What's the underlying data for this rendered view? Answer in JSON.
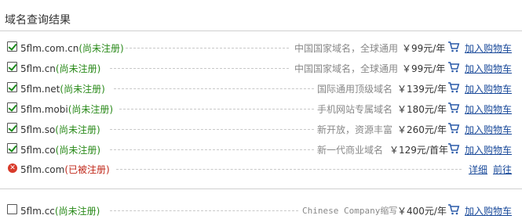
{
  "header": {
    "title": "域名查询结果"
  },
  "results": [
    {
      "domain": "5flm.com.cn",
      "status": "(尚未注册)",
      "desc": "中国国家域名，全球通用",
      "price": "￥99元/年",
      "cart": "加入购物车"
    },
    {
      "domain": "5flm.cn",
      "status": "(尚未注册)",
      "desc": "中国国家域名，全球通用",
      "price": "￥99元/年",
      "cart": "加入购物车"
    },
    {
      "domain": "5flm.net",
      "status": "(尚未注册)",
      "desc": "国际通用顶级域名",
      "price": "￥139元/年",
      "cart": "加入购物车"
    },
    {
      "domain": "5flm.mobi",
      "status": "(尚未注册)",
      "desc": "手机网站专属域名",
      "price": "￥180元/年",
      "cart": "加入购物车"
    },
    {
      "domain": "5flm.so",
      "status": "(尚未注册)",
      "desc": "新开放，资源丰富",
      "price": "￥260元/年",
      "cart": "加入购物车"
    },
    {
      "domain": "5flm.co",
      "status": "(尚未注册)",
      "desc": "新一代商业域名",
      "price": "￥129元/首年",
      "cart": "加入购物车"
    }
  ],
  "taken": {
    "domain": "5flm.com",
    "status": "(已被注册)",
    "details": "详细",
    "goto": "前往"
  },
  "extra": {
    "domain": "5flm.cc",
    "status": "(尚未注册)",
    "desc": "Chinese Company缩写",
    "price": "￥400元/年",
    "cart": "加入购物车"
  },
  "colors": {
    "available": "#2a8a1a",
    "registered": "#c0281a",
    "link": "#1a4a9a"
  }
}
